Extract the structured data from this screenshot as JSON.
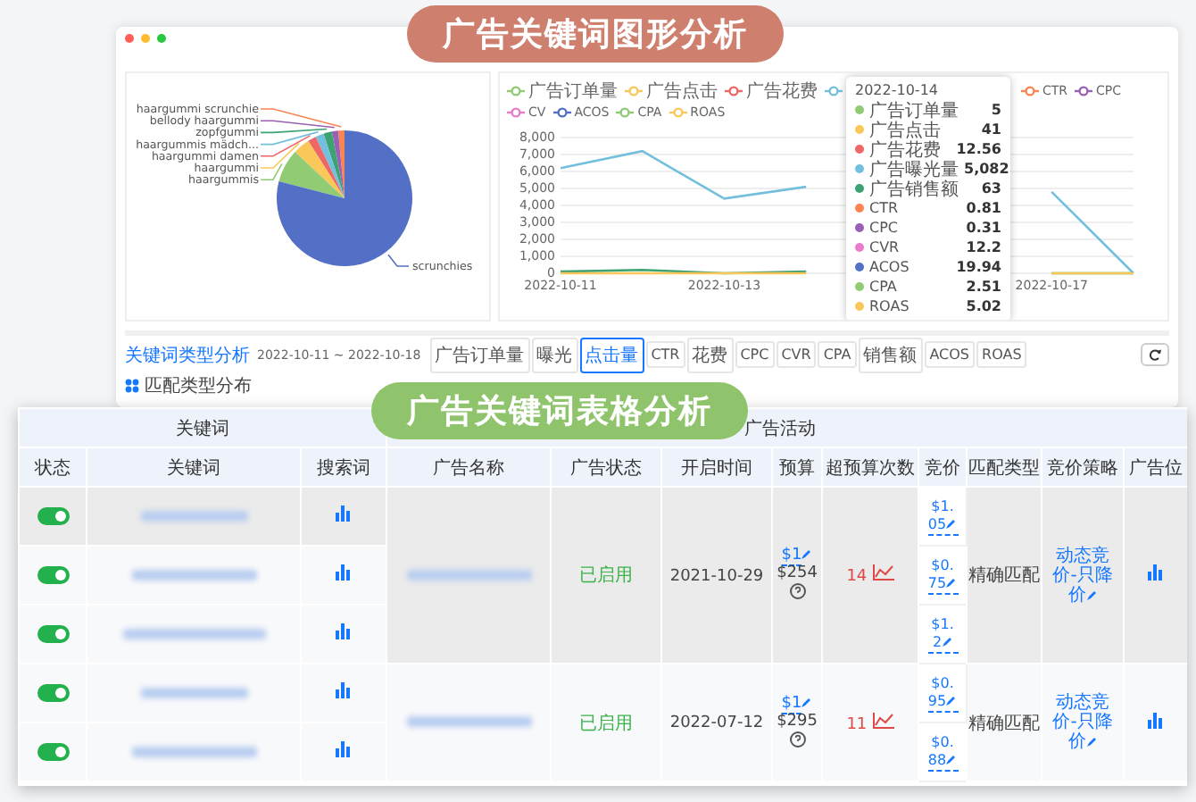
{
  "top_banner": {
    "title": "广告关键词图形分析"
  },
  "pie": {
    "slices": [
      {
        "label": "haargummi scrunchie",
        "color": "#fc8452"
      },
      {
        "label": "bellody haargummi",
        "color": "#9a60b4"
      },
      {
        "label": "zopfgummi",
        "color": "#3ba272"
      },
      {
        "label": "haargummis mädch...",
        "color": "#73c0de"
      },
      {
        "label": "haargummi damen",
        "color": "#ee6666"
      },
      {
        "label": "haargummi",
        "color": "#fac858"
      },
      {
        "label": "haargummis",
        "color": "#91cc75"
      },
      {
        "label": "scrunchies",
        "color": "#5470c6"
      }
    ]
  },
  "legend": [
    {
      "label": "广告订单量",
      "color": "#91cc75"
    },
    {
      "label": "广告点击",
      "color": "#fac858"
    },
    {
      "label": "广告花费",
      "color": "#ee6666"
    },
    {
      "color": "#73c0de"
    },
    {
      "label": "CTR",
      "color": "#fc8452"
    },
    {
      "label": "CPC",
      "color": "#9a60b4"
    },
    {
      "label": "CV",
      "color": "#ea7ccc"
    },
    {
      "label": "ACOS",
      "color": "#5470c6"
    },
    {
      "label": "CPA",
      "color": "#91cc75"
    },
    {
      "label": "ROAS",
      "color": "#fac858"
    }
  ],
  "line_chart": {
    "chart_data": {
      "type": "line",
      "grid": true,
      "categories": [
        "2022-10-11",
        null,
        "2022-10-13",
        null,
        null,
        null,
        "2022-10-17",
        null
      ],
      "ylim": [
        0,
        8000
      ],
      "yticks": [
        {
          "value": 0,
          "label": "0"
        },
        {
          "value": 1000,
          "label": "1,000"
        },
        {
          "value": 2000,
          "label": "2,000"
        },
        {
          "value": 3000,
          "label": "3,000"
        },
        {
          "value": 4000,
          "label": "4,000"
        },
        {
          "value": 5000,
          "label": "5,000"
        },
        {
          "value": 6000,
          "label": "6,000"
        },
        {
          "value": 7000,
          "label": "7,000"
        },
        {
          "value": 8000,
          "label": "8,000"
        }
      ],
      "series": [
        {
          "color": "#73c0de",
          "values": [
            6200,
            7200,
            4400,
            5100,
            null,
            null,
            4800,
            0
          ]
        },
        {
          "color": "#3ba272",
          "values": [
            100,
            200,
            0,
            100,
            null,
            null,
            0,
            0
          ]
        },
        {
          "color": "#fac858",
          "values": [
            0,
            0,
            0,
            0,
            null,
            null,
            0,
            0
          ]
        }
      ]
    }
  },
  "tooltip": {
    "date": "2022-10-14",
    "rows": [
      {
        "name": "广告订单量",
        "value": "5",
        "color": "#91cc75"
      },
      {
        "name": "广告点击",
        "value": "41",
        "color": "#fac858"
      },
      {
        "name": "广告花费",
        "value": "12.56",
        "color": "#ee6666"
      },
      {
        "name": "广告曝光量",
        "value": "5,082",
        "color": "#73c0de"
      },
      {
        "name": "广告销售额",
        "value": "63",
        "color": "#3ba272"
      },
      {
        "name": "CTR",
        "value": "0.81",
        "color": "#fc8452"
      },
      {
        "name": "CPC",
        "value": "0.31",
        "color": "#9a60b4"
      },
      {
        "name": "CVR",
        "value": "12.2",
        "color": "#ea7ccc"
      },
      {
        "name": "ACOS",
        "value": "19.94",
        "color": "#5470c6"
      },
      {
        "name": "CPA",
        "value": "2.51",
        "color": "#91cc75"
      },
      {
        "name": "ROAS",
        "value": "5.02",
        "color": "#fac858"
      }
    ]
  },
  "toolbar": {
    "title": "关键词类型分析",
    "date_range": "2022-10-11 ~ 2022-10-18",
    "tabs": [
      {
        "label": "广告订单量",
        "selected": false
      },
      {
        "label": "曝光",
        "selected": false
      },
      {
        "label": "点击量",
        "selected": true
      },
      {
        "label": "CTR",
        "selected": false
      },
      {
        "label": "花费",
        "selected": false
      },
      {
        "label": "CPC",
        "selected": false
      },
      {
        "label": "CVR",
        "selected": false
      },
      {
        "label": "CPA",
        "selected": false
      },
      {
        "label": "销售额",
        "selected": false
      },
      {
        "label": "ACOS",
        "selected": false
      },
      {
        "label": "ROAS",
        "selected": false
      }
    ],
    "section": "匹配类型分布"
  },
  "table_banner": {
    "title": "广告关键词表格分析"
  },
  "table": {
    "groups": [
      {
        "label": "关键词"
      },
      {
        "label": "广告活动"
      }
    ],
    "columns": [
      "状态",
      "关键词",
      "搜索词",
      "广告名称",
      "广告状态",
      "开启时间",
      "预算",
      "超预算次数",
      "竞价",
      "匹配类型",
      "竞价策略",
      "广告位"
    ],
    "campaigns": [
      {
        "highlighted": true,
        "ad_status": "已启用",
        "start": "2021-10-29",
        "budget": "$1",
        "budget_total": "$254",
        "over_budget": "14",
        "match": "精确匹配",
        "strategy": "动态竞价-只降价",
        "keywords": [
          {
            "on": true,
            "bid": "$1.05"
          },
          {
            "on": true,
            "bid": "$0.75"
          },
          {
            "on": true,
            "bid": "$1.2"
          }
        ]
      },
      {
        "highlighted": false,
        "ad_status": "已启用",
        "start": "2022-07-12",
        "budget": "$1",
        "budget_total": "$295",
        "over_budget": "11",
        "match": "精确匹配",
        "strategy": "动态竞价-只降价",
        "keywords": [
          {
            "on": true,
            "bid": "$0.95"
          },
          {
            "on": true,
            "bid": "$0.88"
          }
        ]
      }
    ]
  }
}
